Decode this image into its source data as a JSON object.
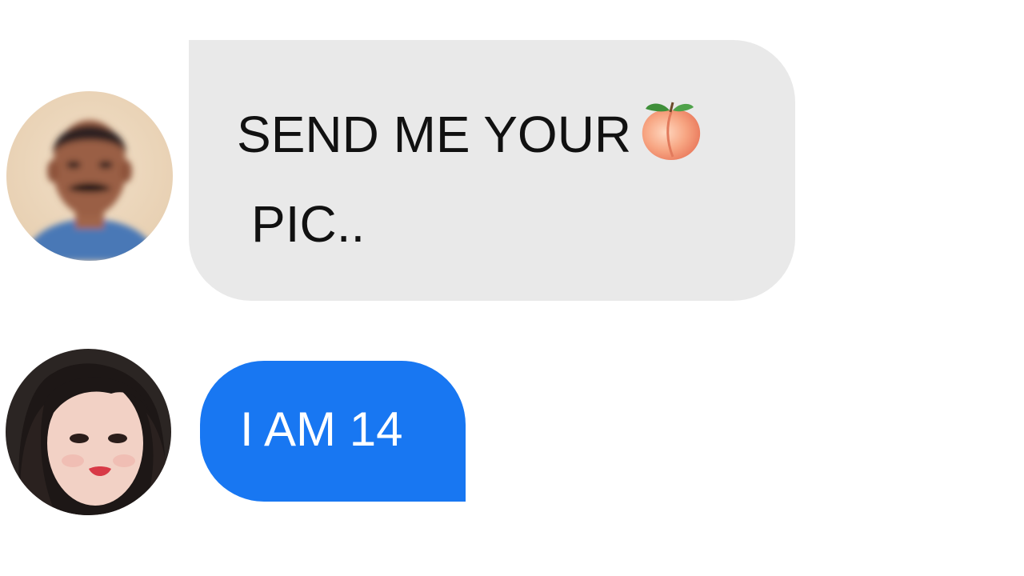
{
  "messages": [
    {
      "sender": "incoming",
      "line1": "SEND ME YOUR",
      "emoji": "peach-icon",
      "line2": "PIC..",
      "colors": {
        "bubble": "#e9e9e9",
        "text": "#111111"
      }
    },
    {
      "sender": "outgoing",
      "text": "I AM 14",
      "colors": {
        "bubble": "#1877f2",
        "text": "#ffffff"
      }
    }
  ]
}
